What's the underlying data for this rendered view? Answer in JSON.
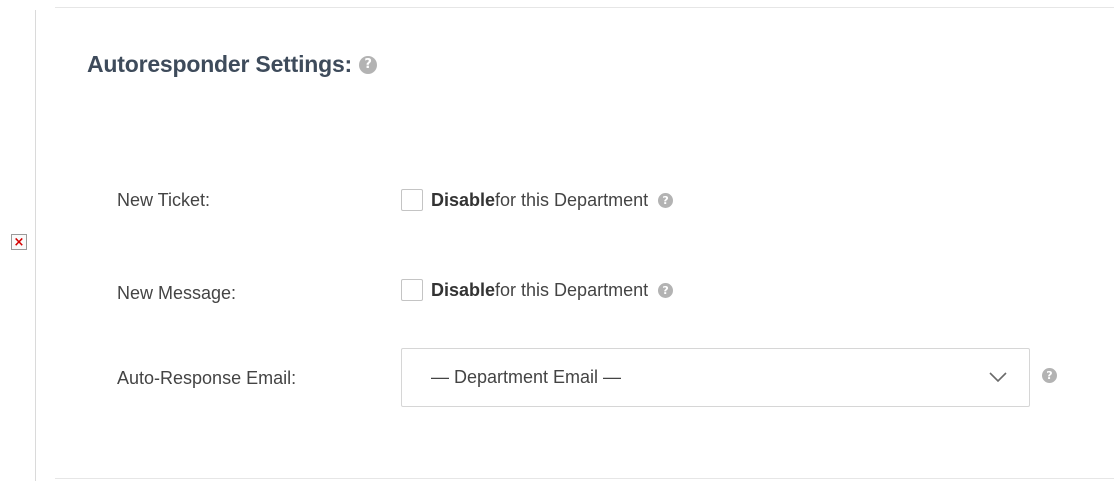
{
  "section": {
    "title": "Autoresponder Settings:",
    "help_icon": "question-circle-icon"
  },
  "broken_image": {
    "glyph": "×",
    "icon": "broken-image-icon"
  },
  "new_ticket": {
    "label": "New Ticket:",
    "checked": false,
    "bold_text": "Disable",
    "text": "for this Department"
  },
  "new_message": {
    "label": "New Message:",
    "checked": false,
    "bold_text": "Disable",
    "text": "for this Department"
  },
  "auto_response_email": {
    "label": "Auto-Response Email:",
    "selected": "— Department Email —"
  },
  "colors": {
    "title": "#3e4b5b",
    "help_icon": "#b3b3b3",
    "border": "#d6d6d6",
    "broken_x": "#d40000"
  }
}
